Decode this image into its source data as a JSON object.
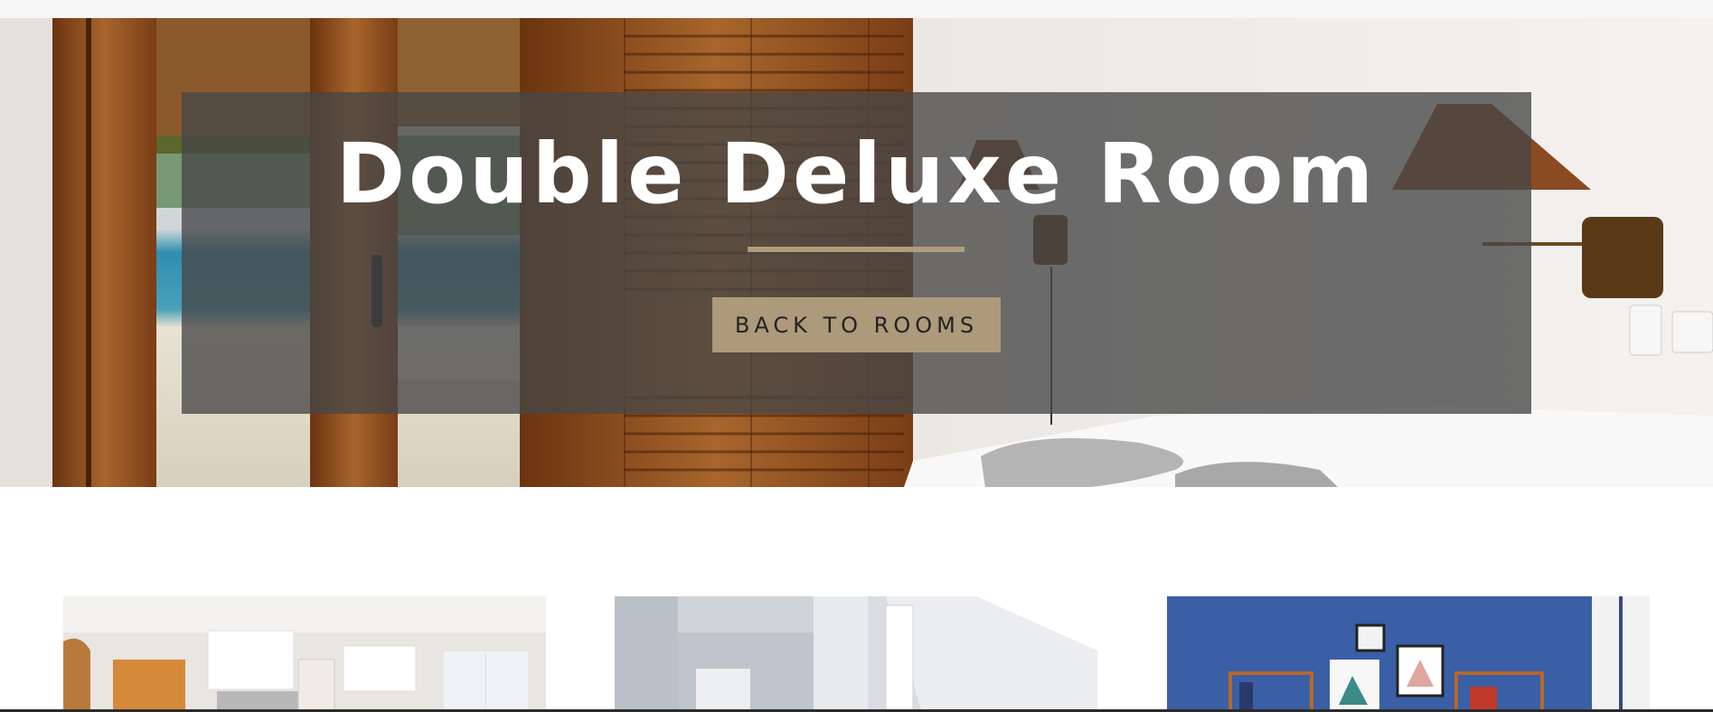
{
  "hero": {
    "title": "Double Deluxe Room",
    "back_button_label": "BACK TO ROOMS"
  },
  "room_cards": [
    {
      "image": "kitchen-photo"
    },
    {
      "image": "bathroom-photo"
    },
    {
      "image": "blue-bedroom-photo"
    }
  ],
  "colors": {
    "accent": "#ad9a7b",
    "overlay": "#464646"
  }
}
